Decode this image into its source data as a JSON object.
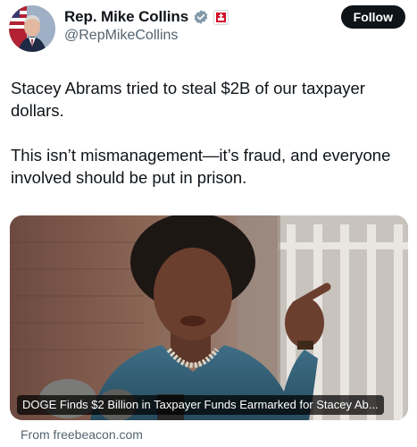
{
  "author": {
    "display_name": "Rep. Mike Collins",
    "handle": "@RepMikeCollins",
    "verified_icon": "gray-checkmark-badge",
    "affiliate_icon": "us-house-seal-badge",
    "avatar": "profile-photo"
  },
  "follow_label": "Follow",
  "tweet": {
    "paragraphs": [
      "Stacey Abrams tried to steal $2B of our taxpayer dollars.",
      "This isn’t mismanagement—it’s fraud, and everyone involved should be put in prison."
    ]
  },
  "link_card": {
    "title": "DOGE Finds $2 Billion in Taxpayer Funds Earmarked for Stacey Ab...",
    "source": "From freebeacon.com",
    "image": "photo-woman-speaking-pointing"
  },
  "colors": {
    "text": "#0f1419",
    "secondary": "#536471",
    "follow_bg": "#0f1419",
    "verified_badge": "#829aab",
    "affiliate_red": "#d0102a"
  }
}
